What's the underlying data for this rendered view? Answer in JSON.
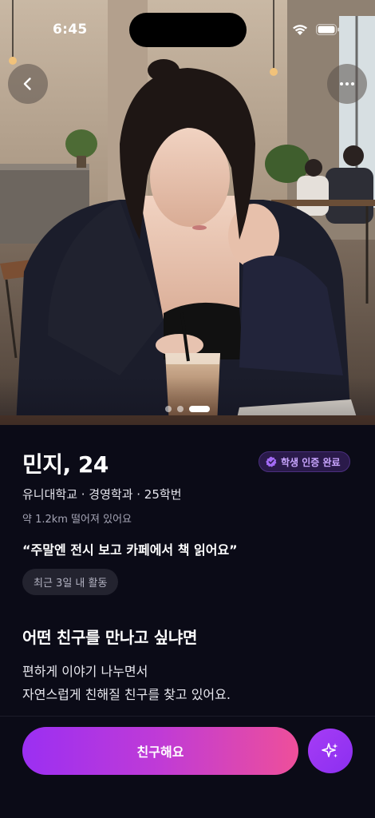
{
  "status_bar": {
    "time": "6:45"
  },
  "photo": {
    "page_count": 3,
    "active_index": 2,
    "back_icon": "chevron-left-icon",
    "more_icon": "more-horizontal-icon"
  },
  "profile": {
    "name_age": "민지, 24",
    "verify_badge": "학생 인증 완료",
    "school_line": "유니대학교 · 경영학과 · 25학번",
    "distance": "약 1.2km 떨어져 있어요",
    "quote": "“주말엔 전시 보고 카페에서 책 읽어요”",
    "activity": "최근 3일 내 활동"
  },
  "ideal_friend": {
    "title": "어떤 친구를 만나고 싶냐면",
    "line1": "편하게 이야기 나누면서",
    "line2": "자연스럽게 친해질 친구를 찾고 있어요."
  },
  "actions": {
    "primary_label": "친구해요",
    "sparkle_icon": "sparkle-icon"
  },
  "colors": {
    "background": "#0b0b17",
    "accent_start": "#9b2ff2",
    "accent_end": "#ee4f9a",
    "badge_text": "#c9a5ff"
  }
}
